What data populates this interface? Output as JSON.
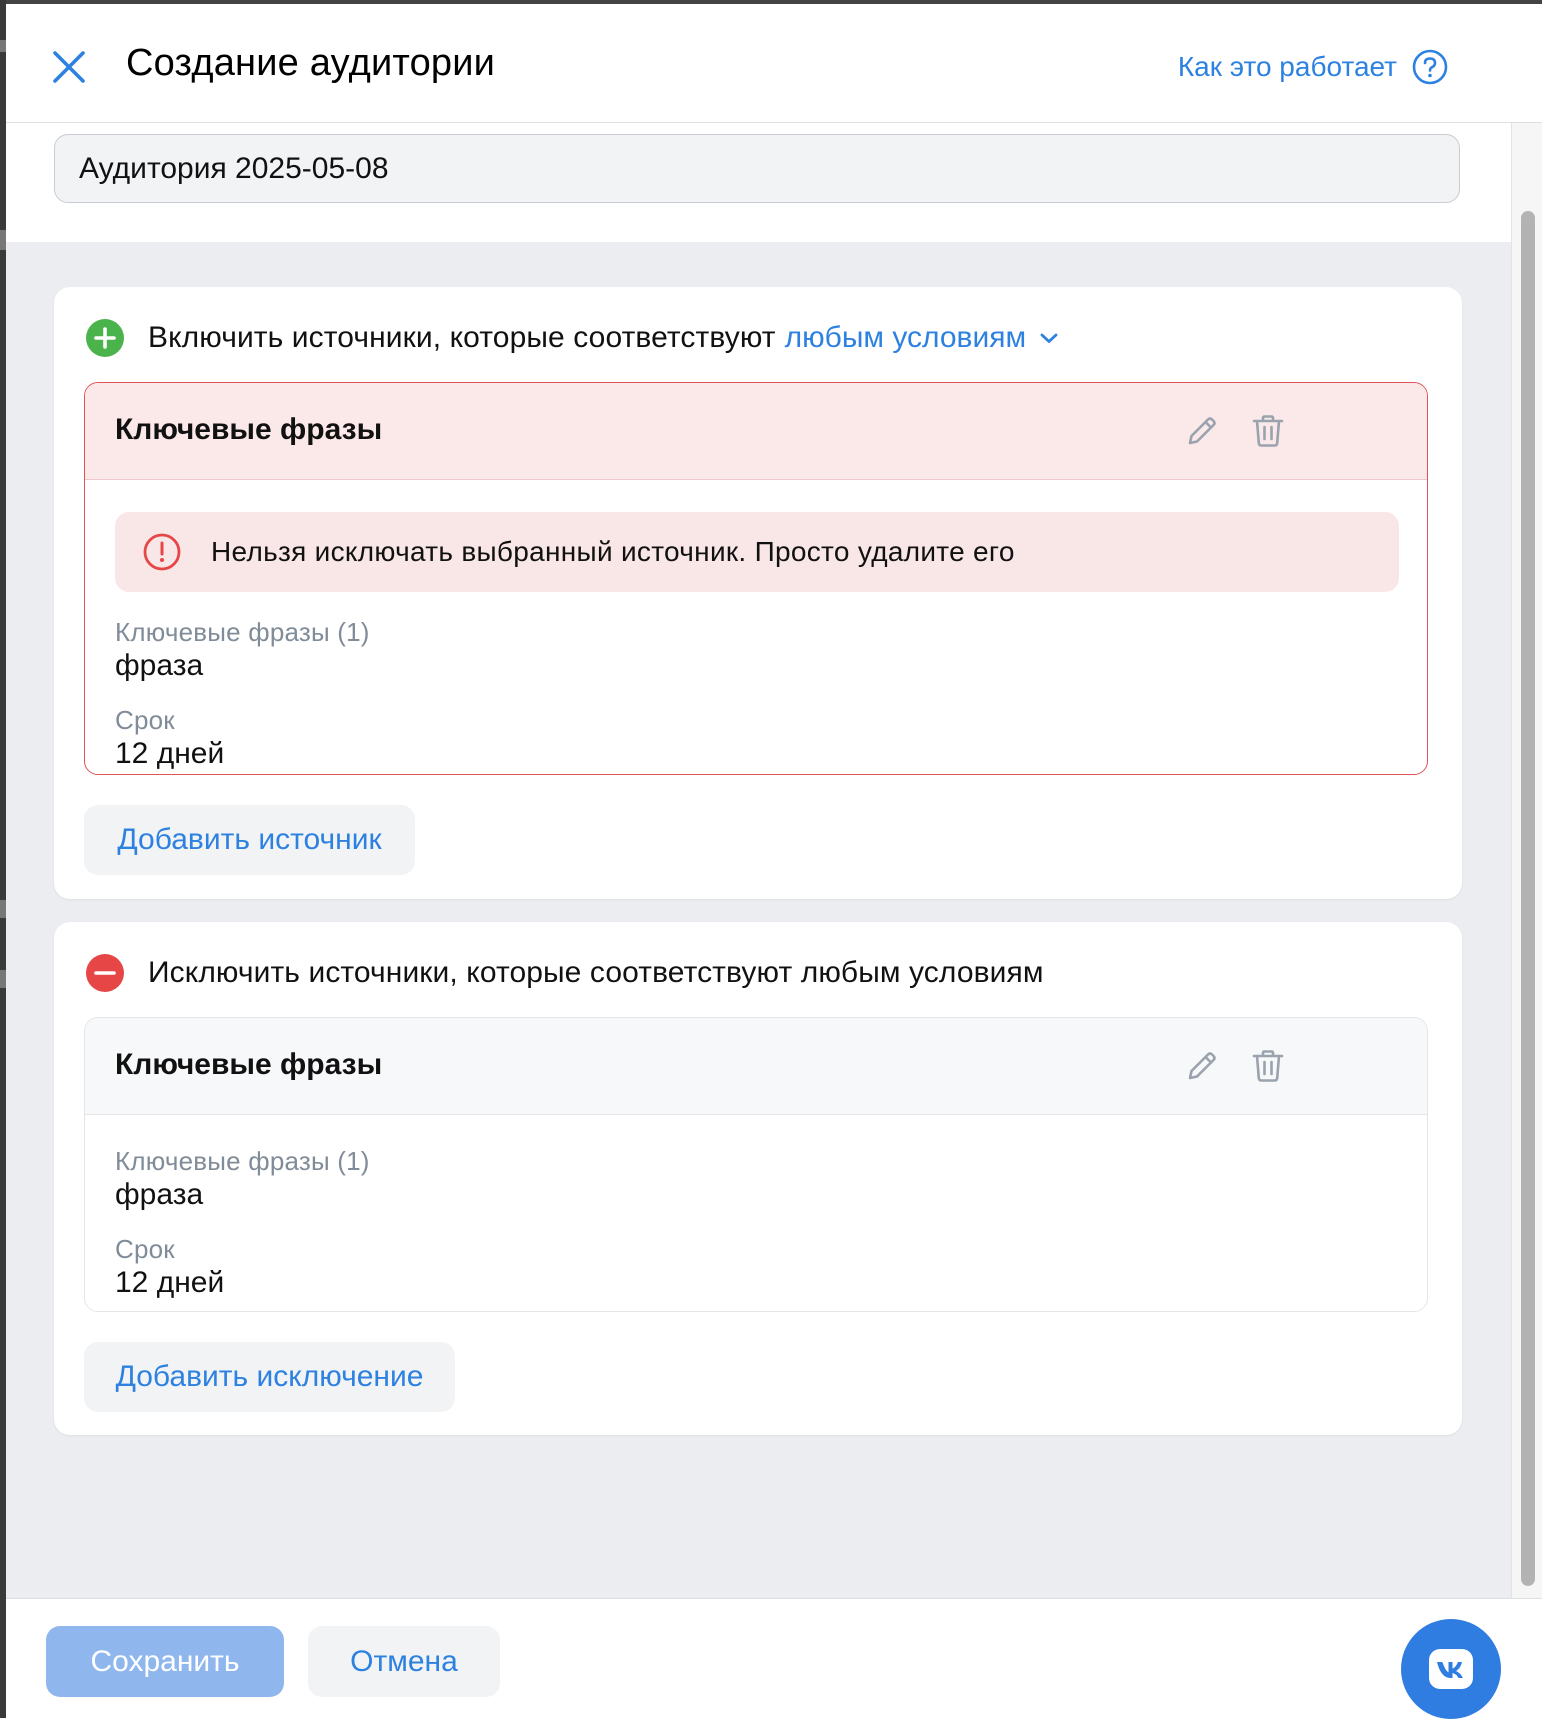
{
  "header": {
    "title": "Создание аудитории",
    "help_link": "Как это работает",
    "close_icon": "close-icon",
    "help_icon": "question-circle-icon"
  },
  "audience_name": {
    "value": "Аудитория 2025-05-08"
  },
  "include_block": {
    "prefix": "Включить источники, которые соответствуют",
    "condition": "любым условиям",
    "icon": "plus-circle-icon",
    "icon_color": "#4bb34b",
    "source": {
      "title": "Ключевые фразы",
      "error": "Нельзя исключать выбранный источник. Просто удалите его",
      "keywords_label": "Ключевые фразы (1)",
      "keywords_value": "фраза",
      "period_label": "Срок",
      "period_value": "12 дней"
    },
    "add_button": "Добавить источник"
  },
  "exclude_block": {
    "text": "Исключить источники, которые соответствуют любым условиям",
    "icon": "minus-circle-icon",
    "icon_color": "#e64646",
    "source": {
      "title": "Ключевые фразы",
      "keywords_label": "Ключевые фразы (1)",
      "keywords_value": "фраза",
      "period_label": "Срок",
      "period_value": "12 дней"
    },
    "add_button": "Добавить исключение"
  },
  "footer": {
    "save": "Сохранить",
    "cancel": "Отмена",
    "fab_icon": "vk-logo-icon"
  },
  "colors": {
    "accent": "#2d81e0",
    "error_border": "#e0545b",
    "error_bg": "#f9e6e7",
    "save_disabled": "#8fb7ee"
  }
}
